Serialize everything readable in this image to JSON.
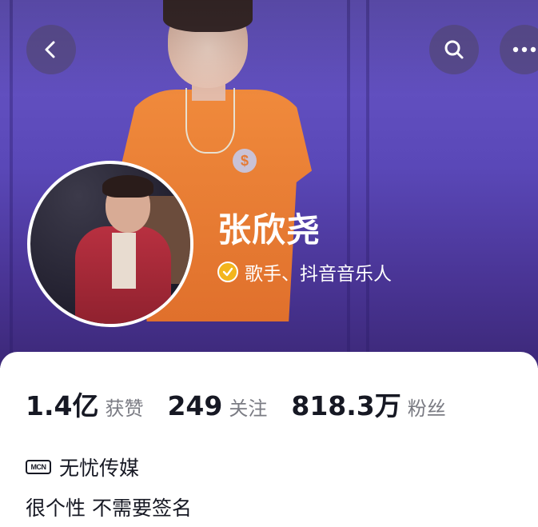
{
  "header": {
    "back_icon": "chevron-left-icon",
    "search_icon": "search-icon",
    "more_icon": "more-horizontal-icon"
  },
  "cover": {
    "shirt_logo": "$"
  },
  "profile": {
    "name": "张欣尧",
    "verified_icon": "verified-check-icon",
    "verified_color": "#f3b51d",
    "verification": "歌手、抖音音乐人"
  },
  "stats": [
    {
      "value": "1.4亿",
      "label": "获赞"
    },
    {
      "value": "249",
      "label": "关注"
    },
    {
      "value": "818.3万",
      "label": "粉丝"
    }
  ],
  "mcn": {
    "icon_text": "MCN",
    "name": "无忧传媒"
  },
  "bio": "很个性 不需要签名",
  "colors": {
    "cover_purple": "#5a48b8",
    "text_primary": "#161823",
    "text_secondary": "#7a7b83"
  }
}
